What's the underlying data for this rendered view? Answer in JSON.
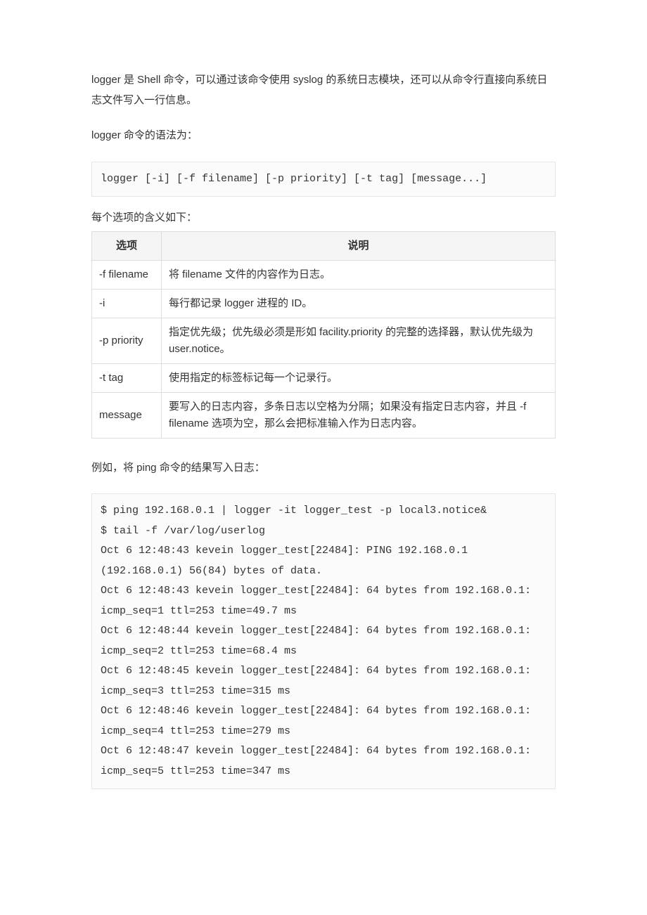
{
  "intro": "logger 是 Shell 命令，可以通过该命令使用 syslog 的系统日志模块，还可以从命令行直接向系统日志文件写入一行信息。",
  "syntax_label": "logger 命令的语法为：",
  "syntax_code": "logger [-i] [-f filename] [-p priority] [-t tag] [message...]",
  "options_label": "每个选项的含义如下：",
  "table": {
    "headers": {
      "option": "选项",
      "desc": "说明"
    },
    "rows": [
      {
        "option": "-f filename",
        "desc": "将 filename 文件的内容作为日志。"
      },
      {
        "option": "-i",
        "desc": "每行都记录 logger 进程的 ID。"
      },
      {
        "option": "-p priority",
        "desc": "指定优先级；优先级必须是形如 facility.priority 的完整的选择器，默认优先级为 user.notice。"
      },
      {
        "option": "-t tag",
        "desc": "使用指定的标签标记每一个记录行。"
      },
      {
        "option": "message",
        "desc": "要写入的日志内容，多条日志以空格为分隔；如果没有指定日志内容，并且 -f filename 选项为空，那么会把标准输入作为日志内容。"
      }
    ]
  },
  "example_label": "例如，将 ping 命令的结果写入日志：",
  "example_code": "$ ping 192.168.0.1 | logger -it logger_test -p local3.notice&\n$ tail -f /var/log/userlog\nOct 6 12:48:43 kevein logger_test[22484]: PING 192.168.0.1 (192.168.0.1) 56(84) bytes of data.\nOct 6 12:48:43 kevein logger_test[22484]: 64 bytes from 192.168.0.1: icmp_seq=1 ttl=253 time=49.7 ms\nOct 6 12:48:44 kevein logger_test[22484]: 64 bytes from 192.168.0.1: icmp_seq=2 ttl=253 time=68.4 ms\nOct 6 12:48:45 kevein logger_test[22484]: 64 bytes from 192.168.0.1: icmp_seq=3 ttl=253 time=315 ms\nOct 6 12:48:46 kevein logger_test[22484]: 64 bytes from 192.168.0.1: icmp_seq=4 ttl=253 time=279 ms\nOct 6 12:48:47 kevein logger_test[22484]: 64 bytes from 192.168.0.1: icmp_seq=5 ttl=253 time=347 ms"
}
